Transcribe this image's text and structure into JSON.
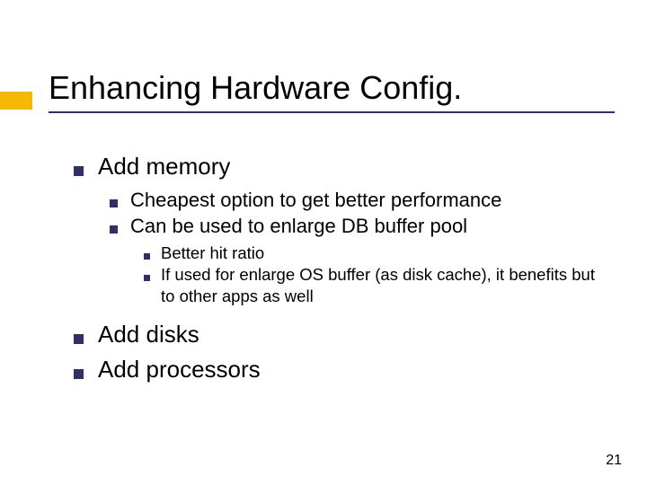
{
  "title": "Enhancing Hardware Config.",
  "bullets": {
    "l1_0": "Add memory",
    "l2_0": "Cheapest option to get better performance",
    "l2_1": "Can be used to enlarge DB buffer pool",
    "l3_0": "Better hit ratio",
    "l3_1": "If used for enlarge OS buffer (as disk cache), it benefits but to other apps as well",
    "l1_1": "Add disks",
    "l1_2": "Add processors"
  },
  "page_number": "21"
}
